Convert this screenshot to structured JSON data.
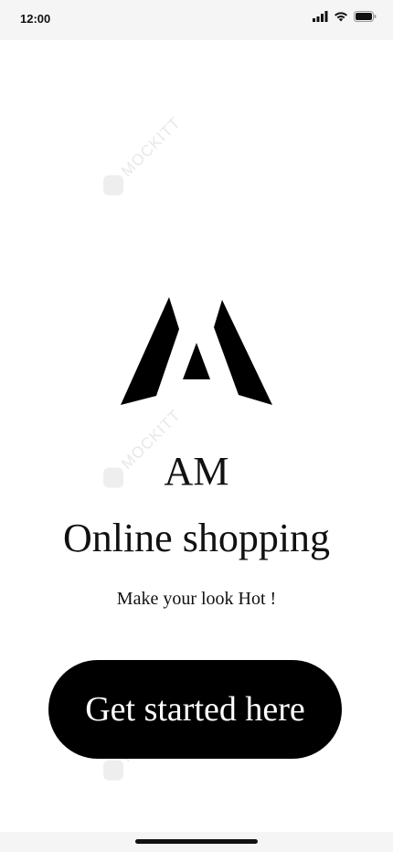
{
  "status_bar": {
    "time": "12:00",
    "icons": [
      "signal-icon",
      "wifi-icon",
      "battery-icon"
    ]
  },
  "watermark": {
    "text": "MOCKITT"
  },
  "hero": {
    "logo_name": "am-logo",
    "brand": "AM",
    "subtitle": "Online shopping",
    "tagline": "Make your look Hot !"
  },
  "cta": {
    "label": "Get started here"
  },
  "colors": {
    "primary": "#000000",
    "background": "#ffffff",
    "system_bar": "#f5f5f5"
  }
}
